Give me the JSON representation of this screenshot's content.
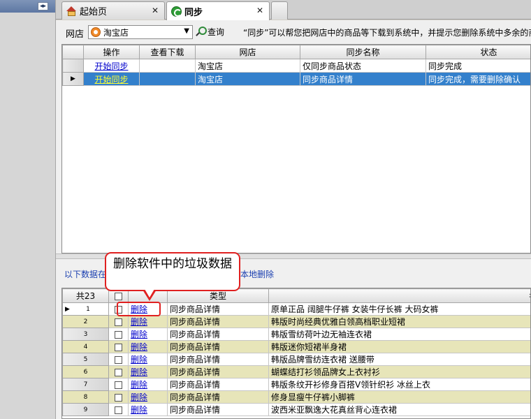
{
  "tabs": [
    {
      "label": "起始页",
      "icon": "home-icon",
      "close": "✕"
    },
    {
      "label": "同步",
      "icon": "sync-icon",
      "close": "✕"
    }
  ],
  "left_pane": {
    "collapse_glyph": "◂▸"
  },
  "toolbar": {
    "store_label": "网店",
    "store_value": "淘宝店",
    "query_label": "查询",
    "hint": "“同步”可以帮您把网店中的商品等下载到系统中，并提示您删除系统中多余的商"
  },
  "sync_grid": {
    "columns": [
      "操作",
      "查看下载",
      "网店",
      "同步名称",
      "状态"
    ],
    "rows": [
      {
        "action": "开始同步",
        "download": "",
        "store": "淘宝店",
        "name": "仅同步商品状态",
        "status": "同步完成"
      },
      {
        "action": "开始同步",
        "download": "",
        "store": "淘宝店",
        "name": "同步商品详情",
        "status": "同步完成，需要删除确认"
      }
    ],
    "selected_row_marker": "▶"
  },
  "desc_text": "以下数据在网店中已经不存在了，需要您手动在本地删除",
  "callout_text": "删除软件中的垃圾数据",
  "garbage_grid": {
    "count_label": "共23",
    "columns": [
      "",
      "",
      "类型",
      "名称"
    ],
    "current_row_marker": "▶",
    "rows": [
      {
        "num": "1",
        "action": "删除",
        "type": "同步商品详情",
        "name": "原单正品 阔腿牛仔裤 女装牛仔长裤 大码女裤"
      },
      {
        "num": "2",
        "action": "删除",
        "type": "同步商品详情",
        "name": "韩版时尚经典优雅白领高档职业短裙"
      },
      {
        "num": "3",
        "action": "删除",
        "type": "同步商品详情",
        "name": "韩版雪纺荷叶边无袖连衣裙"
      },
      {
        "num": "4",
        "action": "删除",
        "type": "同步商品详情",
        "name": "韩版迷你短裙半身裙"
      },
      {
        "num": "5",
        "action": "删除",
        "type": "同步商品详情",
        "name": "韩版品牌雪纺连衣裙 送腰带"
      },
      {
        "num": "6",
        "action": "删除",
        "type": "同步商品详情",
        "name": "蝴蝶结打衫领品牌女上衣衬衫"
      },
      {
        "num": "7",
        "action": "删除",
        "type": "同步商品详情",
        "name": "韩版条纹开衫修身百搭V领针织衫 冰丝上衣"
      },
      {
        "num": "8",
        "action": "删除",
        "type": "同步商品详情",
        "name": "修身显瘦牛仔裤小脚裤"
      },
      {
        "num": "9",
        "action": "删除",
        "type": "同步商品详情",
        "name": "波西米亚飘逸大花真丝背心连衣裙"
      }
    ]
  },
  "colors": {
    "selection": "#3380cc",
    "link": "#0000cc",
    "alt_row": "#e7e5b9",
    "callout_border": "#e02020"
  }
}
